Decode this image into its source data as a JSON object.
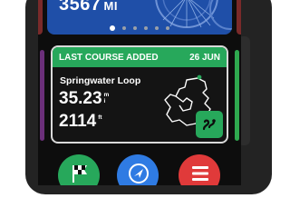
{
  "hero": {
    "value": "3567",
    "unit": "MI"
  },
  "carousel": {
    "page_count": 6,
    "active_index": 0
  },
  "course_card": {
    "header": "LAST COURSE ADDED",
    "date": "26 JUN",
    "name": "Springwater Loop",
    "distance_value": "35.23",
    "distance_unit": "mi",
    "elevation_value": "2114",
    "elevation_unit": "ft"
  },
  "colors": {
    "card_header": "#27a85b",
    "hero": "#1f4fa8",
    "courses_button": "#27a85b",
    "navigate_button": "#2f7be3",
    "menu_button": "#e03a3a"
  },
  "icons": {
    "courses_button": "checkered-flag-icon",
    "navigate_button": "navigation-arrow-icon",
    "menu_button": "menu-icon",
    "route_badge": "route-icon"
  }
}
